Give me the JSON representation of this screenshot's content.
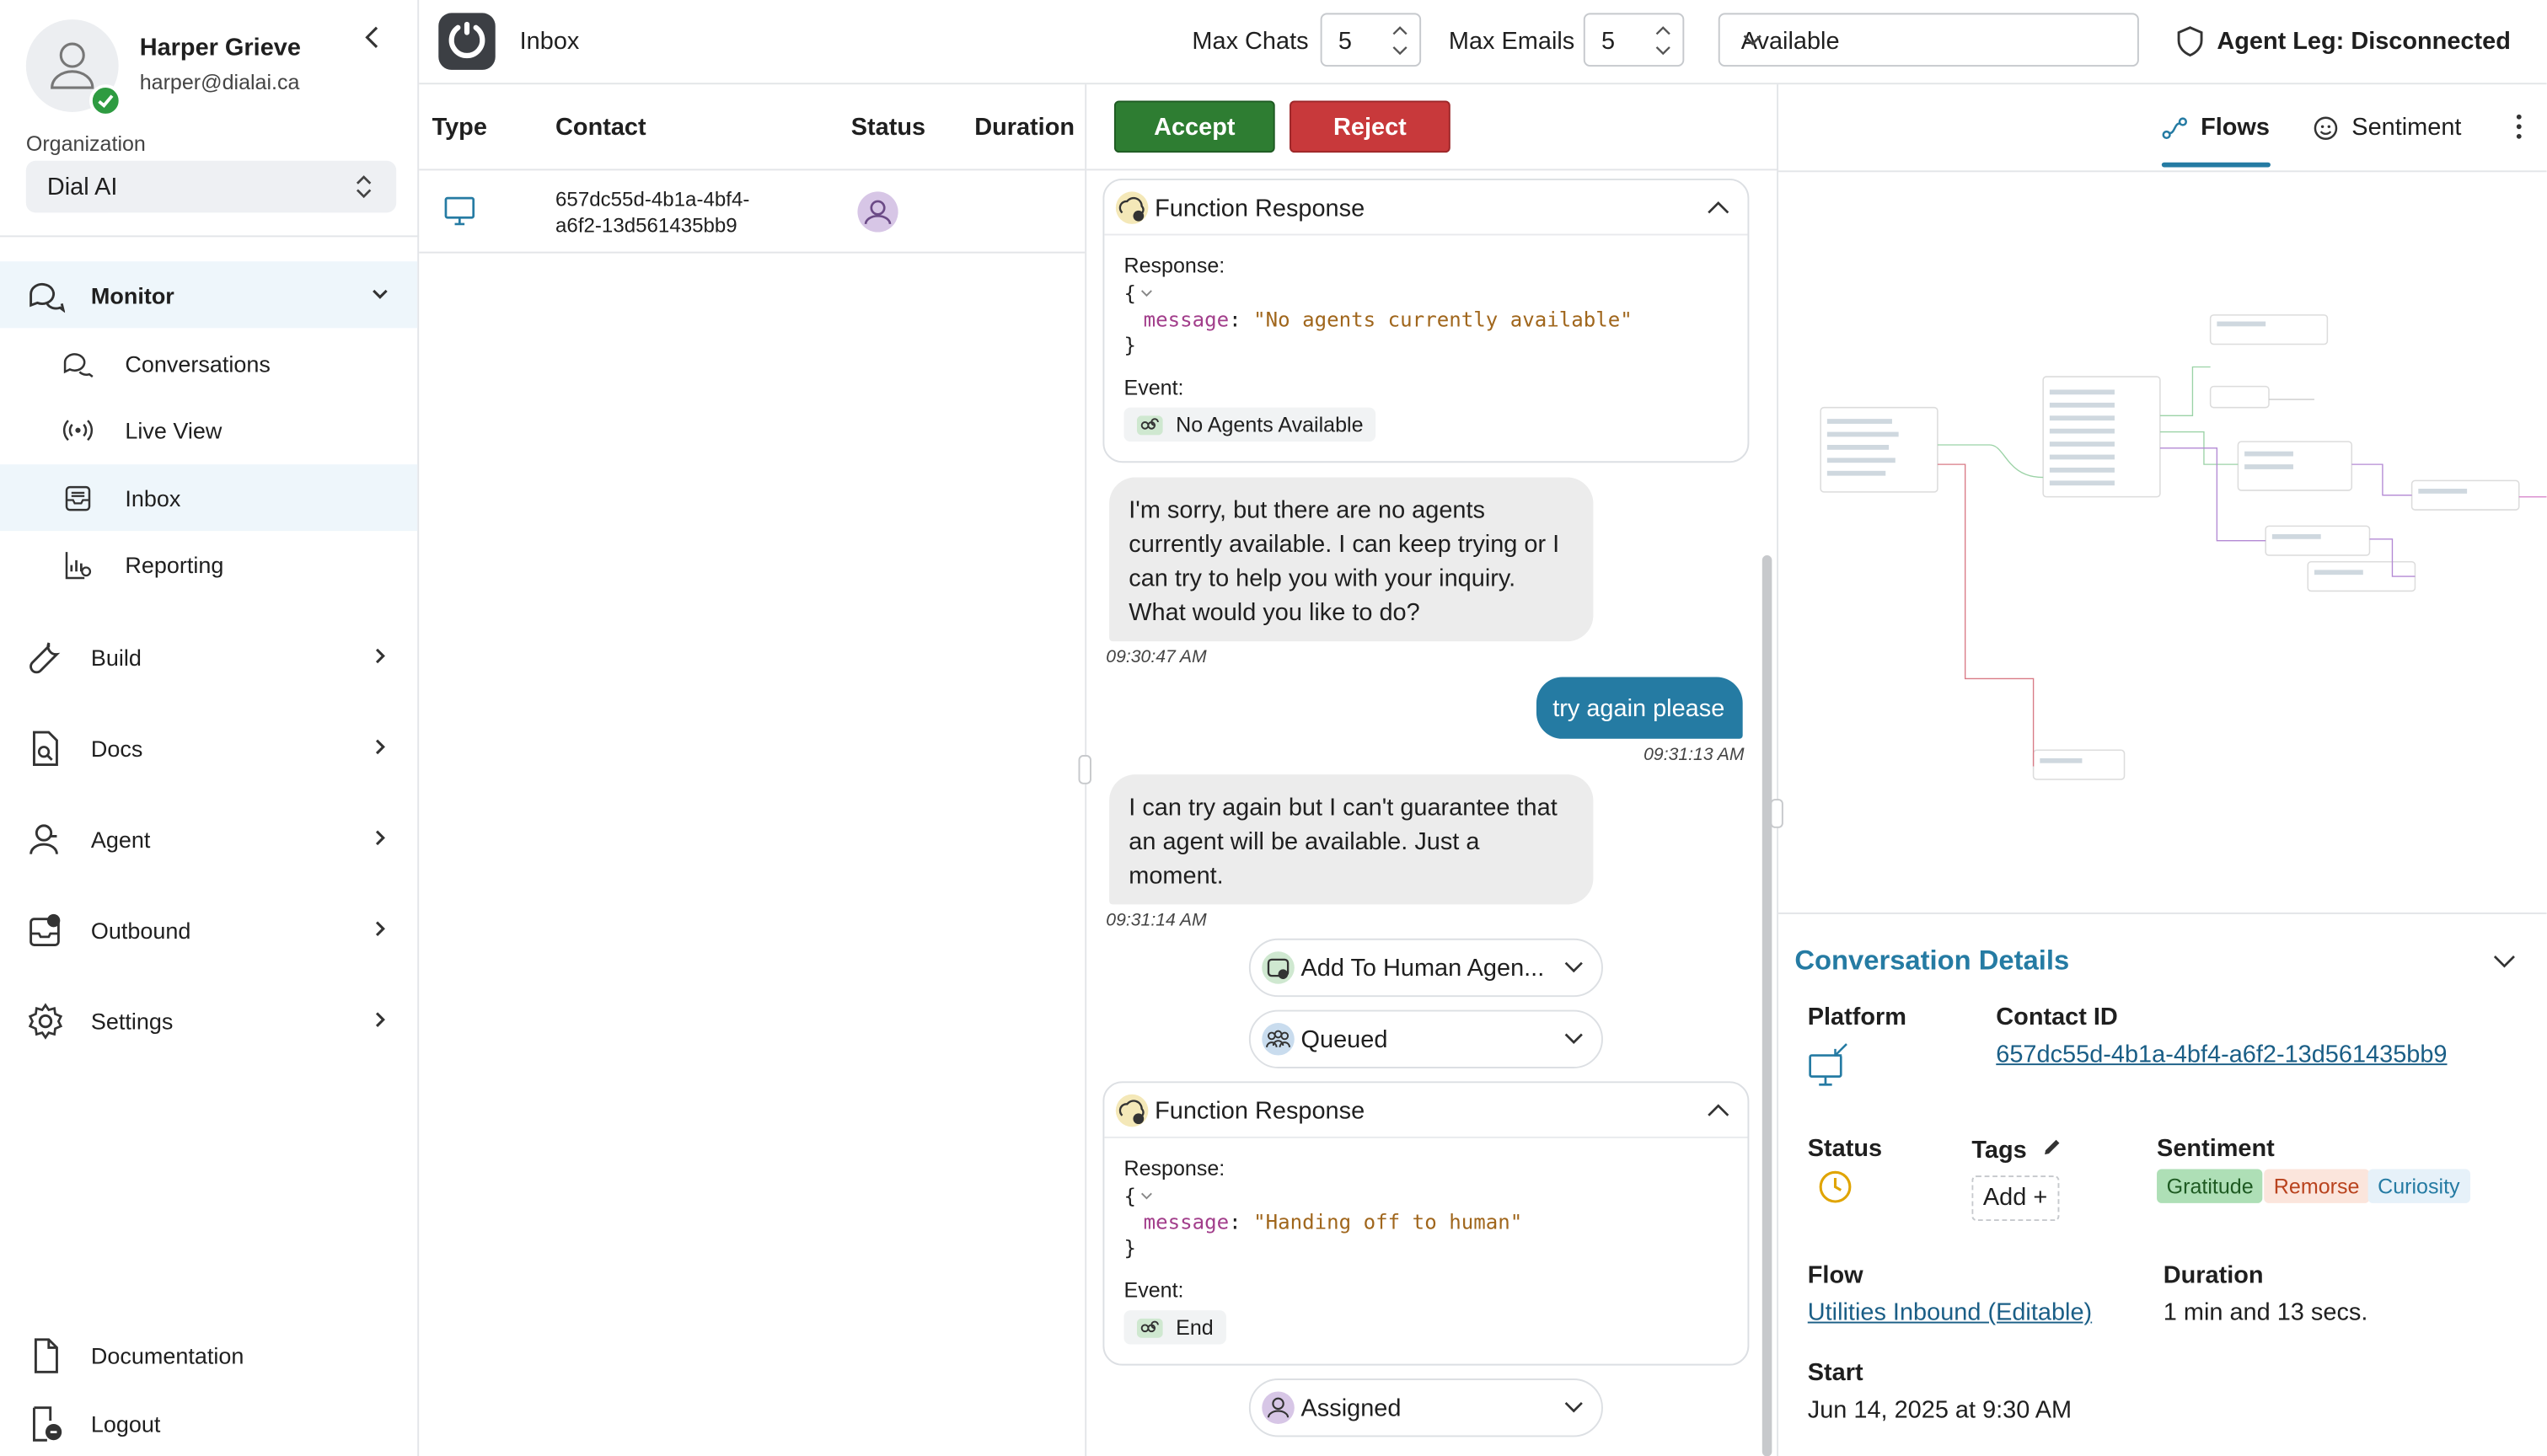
{
  "user": {
    "name": "Harper Grieve",
    "email": "harper@dialai.ca"
  },
  "org": {
    "label": "Organization",
    "value": "Dial AI"
  },
  "nav": {
    "monitor": "Monitor",
    "conversations": "Conversations",
    "live_view": "Live View",
    "inbox": "Inbox",
    "reporting": "Reporting",
    "build": "Build",
    "docs": "Docs",
    "agent": "Agent",
    "outbound": "Outbound",
    "settings": "Settings",
    "documentation": "Documentation",
    "logout": "Logout"
  },
  "topbar": {
    "title": "Inbox",
    "max_chats_label": "Max Chats",
    "max_chats": "5",
    "max_emails_label": "Max Emails",
    "max_emails": "5",
    "availability": "Available",
    "agent_leg": "Agent Leg: Disconnected"
  },
  "list": {
    "headers": {
      "type": "Type",
      "contact": "Contact",
      "status": "Status",
      "duration": "Duration"
    },
    "rows": [
      {
        "contact_line1": "657dc55d-4b1a-4bf4-",
        "contact_line2": "a6f2-13d561435bb9",
        "duration": ""
      }
    ]
  },
  "chat": {
    "accept": "Accept",
    "reject": "Reject",
    "fr1": {
      "title": "Function Response",
      "response_label": "Response:",
      "open": "{",
      "key": "message",
      "value": "\"No agents currently available\"",
      "close": "}",
      "event_label": "Event:",
      "event": "No Agents Available"
    },
    "msg1": {
      "text": "I'm sorry, but there are no agents currently available. I can keep trying or I can try to help you with your inquiry. What would you like to do?",
      "time": "09:30:47 AM"
    },
    "msg2": {
      "text": "try again please",
      "time": "09:31:13 AM"
    },
    "msg3": {
      "text": "I can try again but I can't guarantee that an agent will be available. Just a moment.",
      "time": "09:31:14 AM"
    },
    "pill1": "Add To Human Agen...",
    "pill2": "Queued",
    "fr2": {
      "title": "Function Response",
      "response_label": "Response:",
      "open": "{",
      "key": "message",
      "value": "\"Handing off to human\"",
      "close": "}",
      "event_label": "Event:",
      "event": "End"
    },
    "pill3": "Assigned"
  },
  "right": {
    "tab_flows": "Flows",
    "tab_sentiment": "Sentiment",
    "details_title": "Conversation Details",
    "platform_label": "Platform",
    "contact_id_label": "Contact ID",
    "contact_id": "657dc55d-4b1a-4bf4-a6f2-13d561435bb9",
    "status_label": "Status",
    "tags_label": "Tags",
    "tags_add": "Add +",
    "sentiment_label": "Sentiment",
    "sentiments": [
      "Gratitude",
      "Remorse",
      "Curiosity"
    ],
    "flow_label": "Flow",
    "flow_value": "Utilities Inbound (Editable)",
    "duration_label": "Duration",
    "duration_value": "1 min and 13 secs.",
    "start_label": "Start",
    "start_value": "Jun 14, 2025 at 9:30 AM"
  },
  "colors": {
    "accent": "#257ba3",
    "accept": "#2e7d32",
    "reject": "#c8393b",
    "online": "#2e9b41"
  }
}
